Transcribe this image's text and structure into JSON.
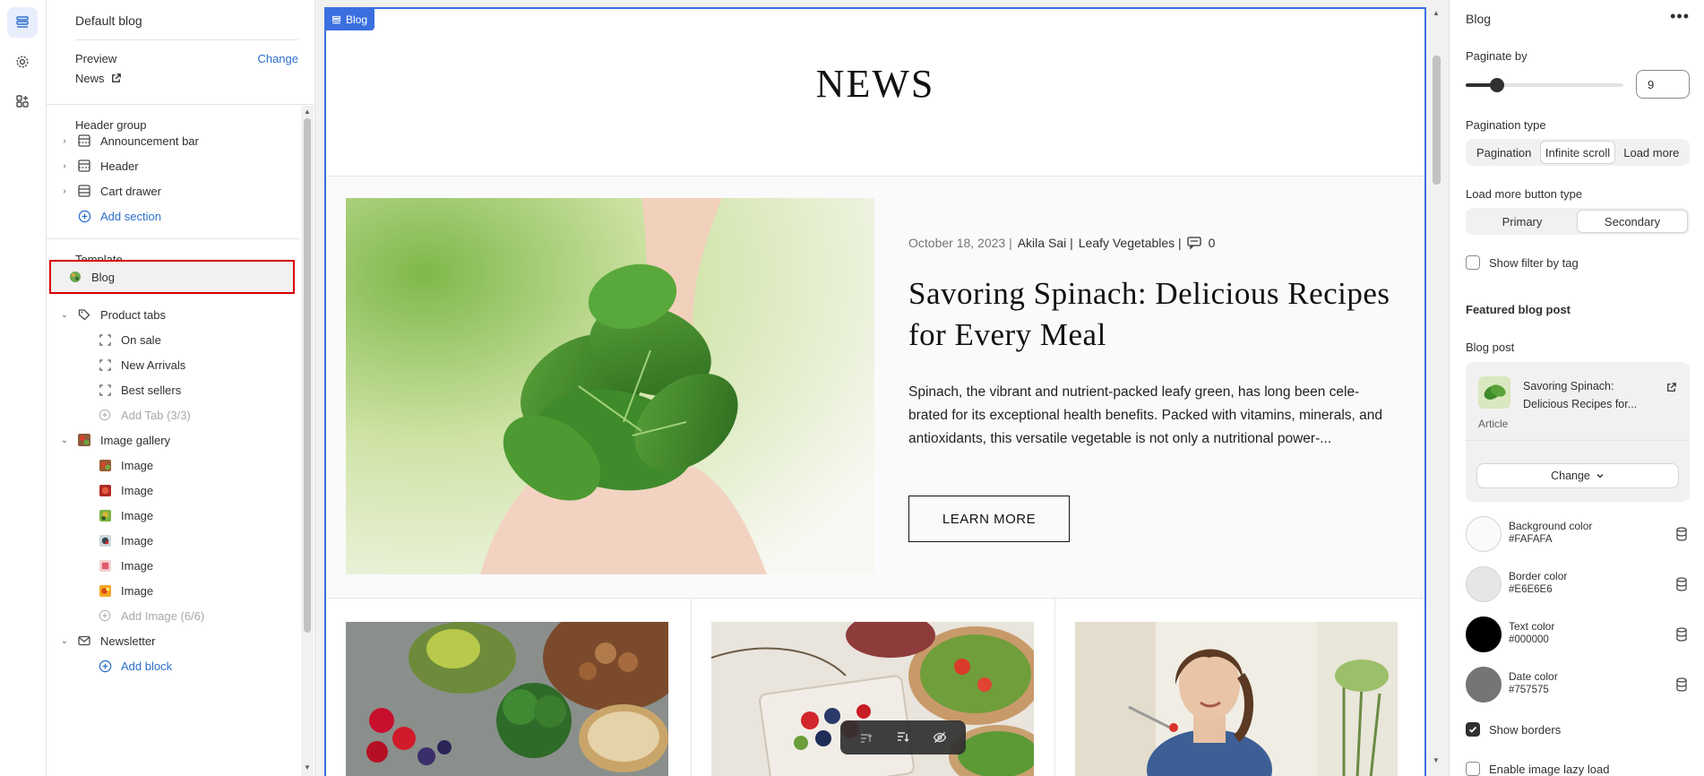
{
  "left_panel": {
    "title": "Default blog",
    "preview_label": "Preview",
    "change_label": "Change",
    "preview_page": "News",
    "header_group": {
      "label": "Header group",
      "items": [
        "Announcement bar",
        "Header",
        "Cart drawer"
      ],
      "add_section": "Add section"
    },
    "template": {
      "label": "Template",
      "selected": "Blog",
      "product_tabs": {
        "label": "Product tabs",
        "children": [
          "On sale",
          "New Arrivals",
          "Best sellers"
        ],
        "add": "Add Tab (3/3)"
      },
      "image_gallery": {
        "label": "Image gallery",
        "children": [
          "Image",
          "Image",
          "Image",
          "Image",
          "Image",
          "Image"
        ],
        "add": "Add Image (6/6)"
      },
      "newsletter": {
        "label": "Newsletter",
        "add": "Add block"
      }
    }
  },
  "canvas": {
    "badge": "Blog",
    "heading": "NEWS",
    "featured": {
      "date": "October 18, 2023 |",
      "author": "Akila Sai |",
      "category": "Leafy Vegetables |",
      "comments": "0",
      "title": "Savoring Spinach: Delicious Recipes for Every Meal",
      "excerpt": "Spinach, the vibrant and nutrient-packed leafy green, has long been cele-brated for its exceptional health benefits. Packed with vitamins, minerals, and antioxidants, this versatile vegetable is not only a nutritional power-...",
      "button": "LEARN MORE"
    }
  },
  "right_panel": {
    "title": "Blog",
    "paginate_label": "Paginate by",
    "paginate_value": "9",
    "paginate_slider_fraction": 0.2,
    "pagination_type_label": "Pagination type",
    "pagination_options": [
      "Pagination",
      "Infinite scroll",
      "Load more"
    ],
    "pagination_selected": "Infinite scroll",
    "load_more_label": "Load more button type",
    "load_more_options": [
      "Primary",
      "Secondary"
    ],
    "load_more_selected": "Secondary",
    "show_filter": "Show filter by tag",
    "featured_heading": "Featured blog post",
    "blog_post_label": "Blog post",
    "post_title": "Savoring Spinach: Delicious Recipes for...",
    "post_type": "Article",
    "change_button": "Change",
    "colors": [
      {
        "name": "Background color",
        "hex": "#FAFAFA"
      },
      {
        "name": "Border color",
        "hex": "#E6E6E6"
      },
      {
        "name": "Text color",
        "hex": "#000000"
      },
      {
        "name": "Date color",
        "hex": "#757575"
      }
    ],
    "show_borders": "Show borders",
    "lazy_load": "Enable image lazy load"
  },
  "theme": {
    "accent": "#3b6fe0",
    "link": "#2c6ecb",
    "selection_border": "#d90000"
  }
}
